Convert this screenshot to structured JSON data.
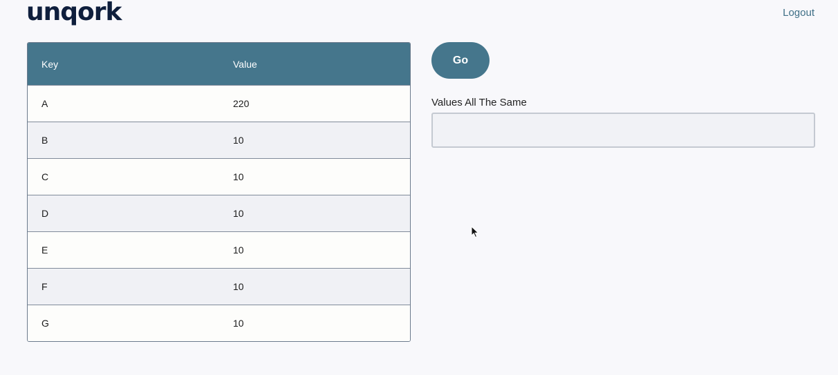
{
  "header": {
    "logo_text": "unqork",
    "logout_label": "Logout"
  },
  "grid": {
    "columns": [
      "Key",
      "Value"
    ],
    "rows": [
      {
        "key": "A",
        "value": "220"
      },
      {
        "key": "B",
        "value": "10"
      },
      {
        "key": "C",
        "value": "10"
      },
      {
        "key": "D",
        "value": "10"
      },
      {
        "key": "E",
        "value": "10"
      },
      {
        "key": "F",
        "value": "10"
      },
      {
        "key": "G",
        "value": "10"
      }
    ]
  },
  "actions": {
    "go_label": "Go"
  },
  "result_field": {
    "label": "Values All The Same",
    "value": ""
  },
  "icons": {
    "cursor": "mouse-pointer-icon"
  },
  "colors": {
    "accent": "#45768c",
    "brand": "#0f1f3d",
    "link": "#3e6f86"
  }
}
